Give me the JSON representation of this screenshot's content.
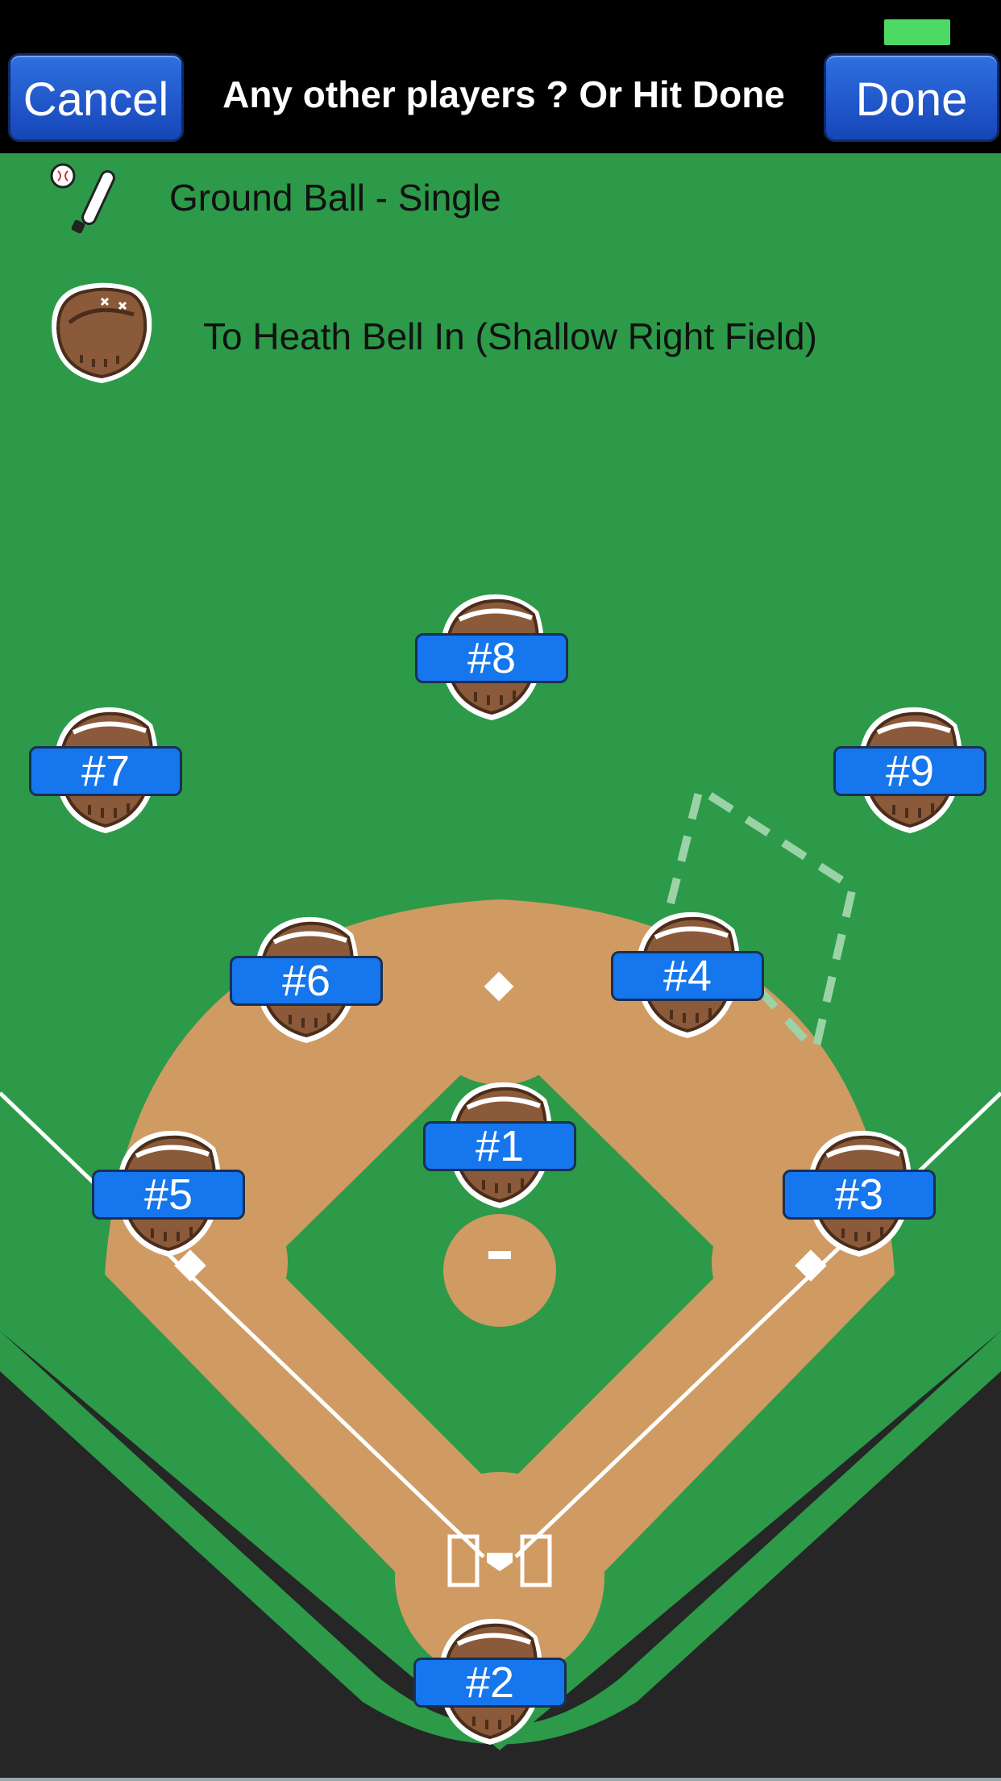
{
  "header": {
    "cancel_label": "Cancel",
    "title": "Any other players ? Or Hit Done",
    "done_label": "Done"
  },
  "play": {
    "hit_type": "Ground Ball - Single",
    "fielded_by": "To Heath Bell In (Shallow Right Field)"
  },
  "players": {
    "p1": "#1",
    "p2": "#2",
    "p3": "#3",
    "p4": "#4",
    "p5": "#5",
    "p6": "#6",
    "p7": "#7",
    "p8": "#8",
    "p9": "#9"
  },
  "colors": {
    "grass": "#2c9a48",
    "dirt": "#d09a63",
    "button_blue": "#1576ee",
    "battery": "#4cd964"
  }
}
